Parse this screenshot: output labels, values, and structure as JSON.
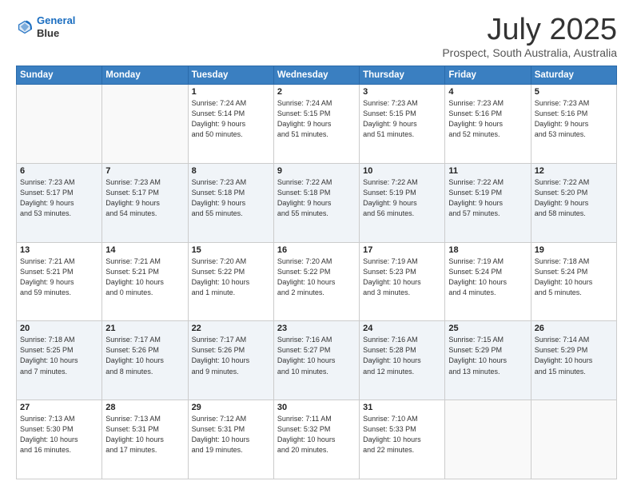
{
  "header": {
    "logo_line1": "General",
    "logo_line2": "Blue",
    "title": "July 2025",
    "subtitle": "Prospect, South Australia, Australia"
  },
  "weekdays": [
    "Sunday",
    "Monday",
    "Tuesday",
    "Wednesday",
    "Thursday",
    "Friday",
    "Saturday"
  ],
  "weeks": [
    [
      {
        "day": "",
        "detail": ""
      },
      {
        "day": "",
        "detail": ""
      },
      {
        "day": "1",
        "detail": "Sunrise: 7:24 AM\nSunset: 5:14 PM\nDaylight: 9 hours\nand 50 minutes."
      },
      {
        "day": "2",
        "detail": "Sunrise: 7:24 AM\nSunset: 5:15 PM\nDaylight: 9 hours\nand 51 minutes."
      },
      {
        "day": "3",
        "detail": "Sunrise: 7:23 AM\nSunset: 5:15 PM\nDaylight: 9 hours\nand 51 minutes."
      },
      {
        "day": "4",
        "detail": "Sunrise: 7:23 AM\nSunset: 5:16 PM\nDaylight: 9 hours\nand 52 minutes."
      },
      {
        "day": "5",
        "detail": "Sunrise: 7:23 AM\nSunset: 5:16 PM\nDaylight: 9 hours\nand 53 minutes."
      }
    ],
    [
      {
        "day": "6",
        "detail": "Sunrise: 7:23 AM\nSunset: 5:17 PM\nDaylight: 9 hours\nand 53 minutes."
      },
      {
        "day": "7",
        "detail": "Sunrise: 7:23 AM\nSunset: 5:17 PM\nDaylight: 9 hours\nand 54 minutes."
      },
      {
        "day": "8",
        "detail": "Sunrise: 7:23 AM\nSunset: 5:18 PM\nDaylight: 9 hours\nand 55 minutes."
      },
      {
        "day": "9",
        "detail": "Sunrise: 7:22 AM\nSunset: 5:18 PM\nDaylight: 9 hours\nand 55 minutes."
      },
      {
        "day": "10",
        "detail": "Sunrise: 7:22 AM\nSunset: 5:19 PM\nDaylight: 9 hours\nand 56 minutes."
      },
      {
        "day": "11",
        "detail": "Sunrise: 7:22 AM\nSunset: 5:19 PM\nDaylight: 9 hours\nand 57 minutes."
      },
      {
        "day": "12",
        "detail": "Sunrise: 7:22 AM\nSunset: 5:20 PM\nDaylight: 9 hours\nand 58 minutes."
      }
    ],
    [
      {
        "day": "13",
        "detail": "Sunrise: 7:21 AM\nSunset: 5:21 PM\nDaylight: 9 hours\nand 59 minutes."
      },
      {
        "day": "14",
        "detail": "Sunrise: 7:21 AM\nSunset: 5:21 PM\nDaylight: 10 hours\nand 0 minutes."
      },
      {
        "day": "15",
        "detail": "Sunrise: 7:20 AM\nSunset: 5:22 PM\nDaylight: 10 hours\nand 1 minute."
      },
      {
        "day": "16",
        "detail": "Sunrise: 7:20 AM\nSunset: 5:22 PM\nDaylight: 10 hours\nand 2 minutes."
      },
      {
        "day": "17",
        "detail": "Sunrise: 7:19 AM\nSunset: 5:23 PM\nDaylight: 10 hours\nand 3 minutes."
      },
      {
        "day": "18",
        "detail": "Sunrise: 7:19 AM\nSunset: 5:24 PM\nDaylight: 10 hours\nand 4 minutes."
      },
      {
        "day": "19",
        "detail": "Sunrise: 7:18 AM\nSunset: 5:24 PM\nDaylight: 10 hours\nand 5 minutes."
      }
    ],
    [
      {
        "day": "20",
        "detail": "Sunrise: 7:18 AM\nSunset: 5:25 PM\nDaylight: 10 hours\nand 7 minutes."
      },
      {
        "day": "21",
        "detail": "Sunrise: 7:17 AM\nSunset: 5:26 PM\nDaylight: 10 hours\nand 8 minutes."
      },
      {
        "day": "22",
        "detail": "Sunrise: 7:17 AM\nSunset: 5:26 PM\nDaylight: 10 hours\nand 9 minutes."
      },
      {
        "day": "23",
        "detail": "Sunrise: 7:16 AM\nSunset: 5:27 PM\nDaylight: 10 hours\nand 10 minutes."
      },
      {
        "day": "24",
        "detail": "Sunrise: 7:16 AM\nSunset: 5:28 PM\nDaylight: 10 hours\nand 12 minutes."
      },
      {
        "day": "25",
        "detail": "Sunrise: 7:15 AM\nSunset: 5:29 PM\nDaylight: 10 hours\nand 13 minutes."
      },
      {
        "day": "26",
        "detail": "Sunrise: 7:14 AM\nSunset: 5:29 PM\nDaylight: 10 hours\nand 15 minutes."
      }
    ],
    [
      {
        "day": "27",
        "detail": "Sunrise: 7:13 AM\nSunset: 5:30 PM\nDaylight: 10 hours\nand 16 minutes."
      },
      {
        "day": "28",
        "detail": "Sunrise: 7:13 AM\nSunset: 5:31 PM\nDaylight: 10 hours\nand 17 minutes."
      },
      {
        "day": "29",
        "detail": "Sunrise: 7:12 AM\nSunset: 5:31 PM\nDaylight: 10 hours\nand 19 minutes."
      },
      {
        "day": "30",
        "detail": "Sunrise: 7:11 AM\nSunset: 5:32 PM\nDaylight: 10 hours\nand 20 minutes."
      },
      {
        "day": "31",
        "detail": "Sunrise: 7:10 AM\nSunset: 5:33 PM\nDaylight: 10 hours\nand 22 minutes."
      },
      {
        "day": "",
        "detail": ""
      },
      {
        "day": "",
        "detail": ""
      }
    ]
  ]
}
